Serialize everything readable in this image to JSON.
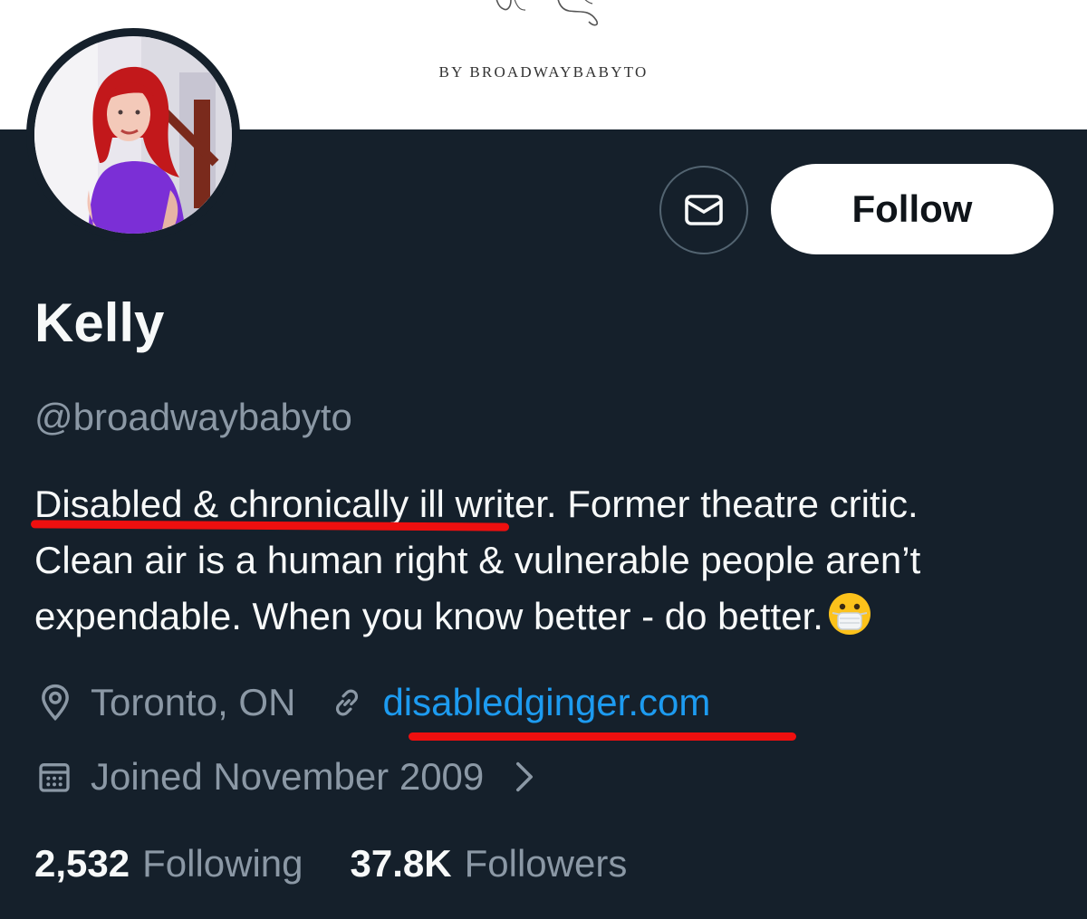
{
  "banner": {
    "caption": "BY BROADWAYBABYTO"
  },
  "profile": {
    "display_name": "Kelly",
    "handle": "@broadwaybabyto",
    "bio_lines": [
      "Disabled & chronically ill writer. Former theatre critic.",
      "Clean air is a human right & vulnerable people aren’t",
      "expendable. When you know better - do better."
    ],
    "location": "Toronto, ON",
    "website": "disabledginger.com",
    "joined": "Joined November 2009",
    "following_count": "2,532",
    "following_label": "Following",
    "followers_count": "37.8K",
    "followers_label": "Followers"
  },
  "actions": {
    "follow_label": "Follow",
    "message_icon": "envelope-icon"
  },
  "icons": {
    "location": "location-pin-icon",
    "website": "link-icon",
    "joined": "calendar-icon",
    "chevron": "chevron-right-icon",
    "bio_emoji": "face-with-medical-mask-emoji"
  },
  "colors": {
    "background": "#15202b",
    "primary_text": "#f7f9f9",
    "secondary_text": "#8b98a5",
    "link": "#1d9bf0",
    "annotation_underline": "#ee0f0f",
    "follow_button_bg": "#ffffff"
  }
}
